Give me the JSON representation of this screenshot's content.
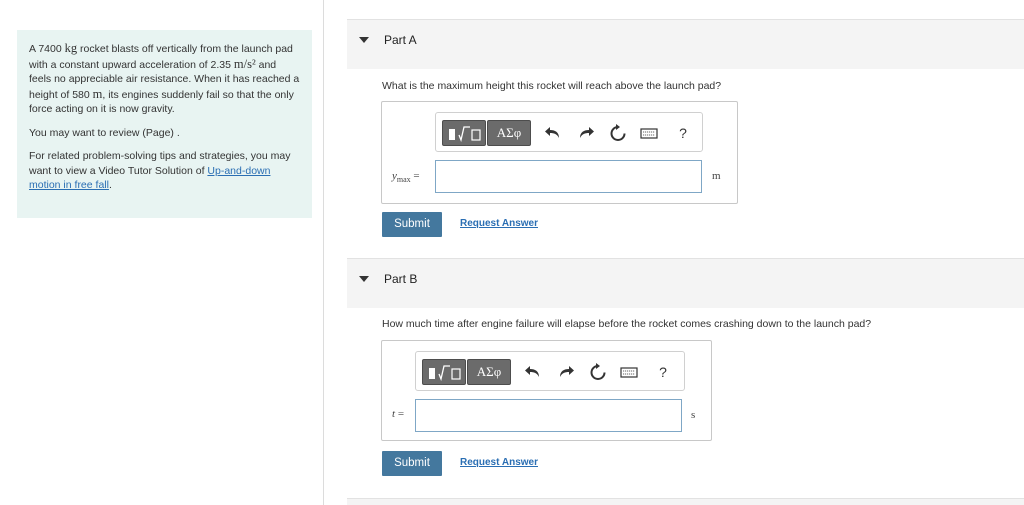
{
  "problem": {
    "text_1": "A 7400",
    "mass_unit": "kg",
    "text_2": "rocket blasts off vertically from the launch pad with a constant upward acceleration of 2.35",
    "accel_unit": "m/s²",
    "text_3": "and feels no appreciable air resistance. When it has reached a height of 580",
    "height_unit": "m",
    "text_4": ", its engines suddenly fail so that the only force acting on it is now gravity.",
    "review_text": "You may want to review (Page) .",
    "related_text": "For related problem-solving tips and strategies, you may want to view a Video Tutor Solution of",
    "related_link": "Up-and-down motion in free fall",
    "related_end": "."
  },
  "toolbar": {
    "templates_label": "▮√▢",
    "symbols_label": "ΑΣφ",
    "help_label": "?",
    "undo_icon": "undo-icon",
    "redo_icon": "redo-icon",
    "reset_icon": "reset-icon",
    "keyboard_icon": "keyboard-icon"
  },
  "parts": [
    {
      "title": "Part A",
      "question": "What is the maximum height this rocket will reach above the launch pad?",
      "var_main": "y",
      "var_sub": "max",
      "equals": "=",
      "input_value": "",
      "unit": "m",
      "submit": "Submit",
      "request": "Request Answer"
    },
    {
      "title": "Part B",
      "question": "How much time after engine failure will elapse before the rocket comes crashing down to the launch pad?",
      "var_main": "t",
      "var_sub": "",
      "equals": "=",
      "input_value": "",
      "unit": "s",
      "submit": "Submit",
      "request": "Request Answer"
    }
  ]
}
